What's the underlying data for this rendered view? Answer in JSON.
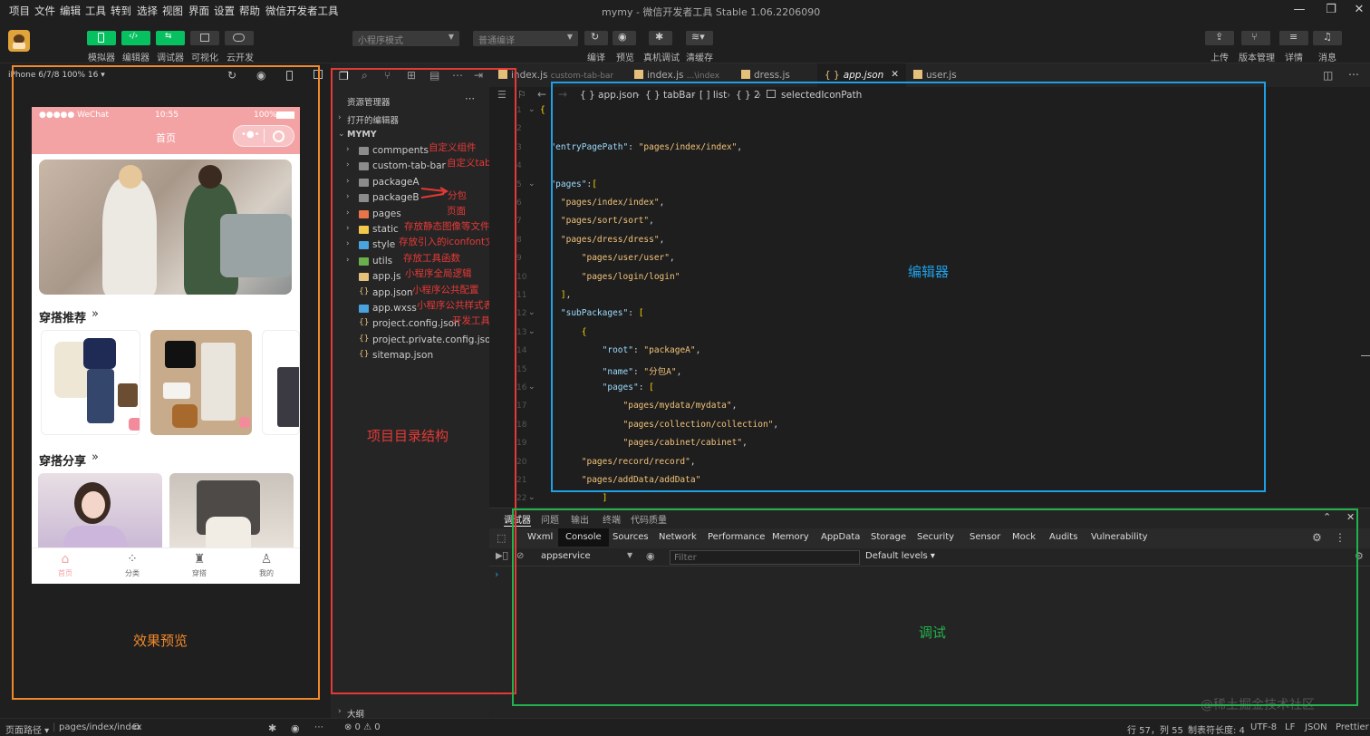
{
  "menubar": {
    "items": [
      "项目",
      "文件",
      "编辑",
      "工具",
      "转到",
      "选择",
      "视图",
      "界面",
      "设置",
      "帮助",
      "微信开发者工具"
    ],
    "title": "mymy - 微信开发者工具 Stable 1.06.2206090"
  },
  "toolbar": {
    "left_buttons": [
      "模拟器",
      "编辑器",
      "调试器",
      "可视化",
      "云开发"
    ],
    "mode_select": "小程序模式",
    "compile_select": "普通编译",
    "center_buttons": [
      "编译",
      "预览",
      "真机调试",
      "清缓存"
    ],
    "right_buttons": [
      "上传",
      "版本管理",
      "详情",
      "消息"
    ]
  },
  "simulator": {
    "device": "iPhone 6/7/8 100% 16 ▾",
    "status_left": "●●●●● WeChat",
    "status_time": "10:55",
    "status_battery": "100%",
    "page_title": "首页",
    "section1": "穿搭推荐",
    "section2": "穿搭分享",
    "tabs": [
      "首页",
      "分类",
      "穿搭",
      "我的"
    ]
  },
  "explorer": {
    "header": "资源管理器",
    "open_editors": "打开的编辑器",
    "root": "MYMY",
    "items": [
      {
        "name": "commpents",
        "type": "folder",
        "note": "自定义组件"
      },
      {
        "name": "custom-tab-bar",
        "type": "folder",
        "note": "自定义tabbar"
      },
      {
        "name": "packageA",
        "type": "folder",
        "note": ""
      },
      {
        "name": "packageB",
        "type": "folder",
        "note": "分包"
      },
      {
        "name": "pages",
        "type": "folder-pages",
        "note": "页面"
      },
      {
        "name": "static",
        "type": "folder-static",
        "note": "存放静态图像等文件"
      },
      {
        "name": "style",
        "type": "folder-style",
        "note": "存放引入的iconfont文件，样式"
      },
      {
        "name": "utils",
        "type": "folder-utils",
        "note": "存放工具函数"
      },
      {
        "name": "app.js",
        "type": "js",
        "note": "小程序全局逻辑"
      },
      {
        "name": "app.json",
        "type": "json",
        "note": "小程序公共配置"
      },
      {
        "name": "app.wxss",
        "type": "wxss",
        "note": "小程序公共样式表"
      },
      {
        "name": "project.config.json",
        "type": "json",
        "note": "开发工具配置文件"
      },
      {
        "name": "project.private.config.json",
        "type": "json",
        "note": ""
      },
      {
        "name": "sitemap.json",
        "type": "json",
        "note": ""
      }
    ],
    "outline": "大纲"
  },
  "editor": {
    "tabs": [
      {
        "name": "index.js",
        "hint": "custom-tab-bar"
      },
      {
        "name": "index.js",
        "hint": "...\\index"
      },
      {
        "name": "dress.js",
        "hint": ""
      },
      {
        "name": "app.json",
        "hint": ""
      },
      {
        "name": "user.js",
        "hint": ""
      }
    ],
    "breadcrumb": [
      "{ } app.json",
      "{ } tabBar",
      "[ ] list",
      "{ } 2",
      "selectedIconPath"
    ],
    "lines": [
      "{",
      "",
      "  \"entryPagePath\": \"pages/index/index\",",
      "",
      "  \"pages\":[",
      "    \"pages/index/index\",",
      "    \"pages/sort/sort\",",
      "    \"pages/dress/dress\",",
      "        \"pages/user/user\",",
      "        \"pages/login/login\"",
      "    ],",
      "    \"subPackages\": [",
      "        {",
      "            \"root\": \"packageA\",",
      "            \"name\": \"分包A\",",
      "            \"pages\": [",
      "                \"pages/mydata/mydata\",",
      "                \"pages/collection/collection\",",
      "                \"pages/cabinet/cabinet\",",
      "        \"pages/record/record\",",
      "        \"pages/addData/addData\"",
      "            ]",
      "    },",
      "    {"
    ]
  },
  "debugger": {
    "tabs": [
      "调试器",
      "问题",
      "输出",
      "终端",
      "代码质量"
    ],
    "panels": [
      "Wxml",
      "Console",
      "Sources",
      "Network",
      "Performance",
      "Memory",
      "AppData",
      "Storage",
      "Security",
      "Sensor",
      "Mock",
      "Audits",
      "Vulnerability"
    ],
    "context": "appservice",
    "filter_placeholder": "Filter",
    "levels": "Default levels ▾"
  },
  "labels": {
    "preview": "效果预览",
    "directory": "项目目录结构",
    "editor": "编辑器",
    "debug": "调试",
    "watermark": "@稀土掘金技术社区"
  },
  "statusbar": {
    "path_label": "页面路径 ▾",
    "path": "pages/index/index",
    "errors": "⊗ 0 ⚠ 0",
    "position": "行 57，列 55",
    "tab_size": "制表符长度: 4",
    "encoding": "UTF-8",
    "eol": "LF",
    "lang": "JSON",
    "formatter": "Prettier"
  },
  "colors": {
    "orange": "#f0892b",
    "red": "#e53935",
    "blue": "#1ea0e6",
    "green": "#22b14c",
    "brand": "#07c160",
    "nav_pink": "#f4a3a5"
  }
}
